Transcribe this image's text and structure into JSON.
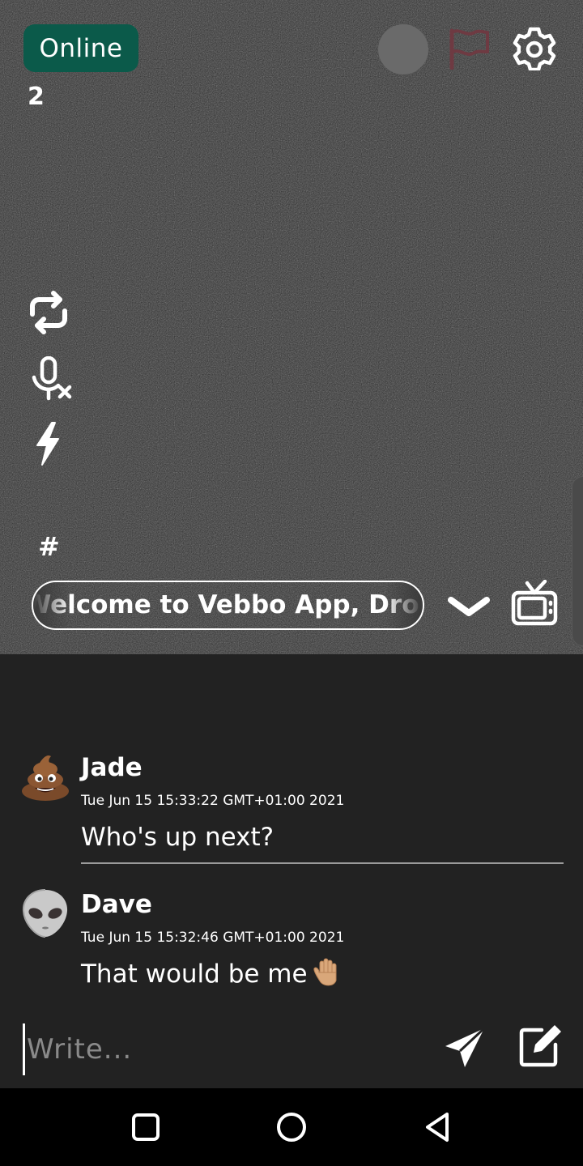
{
  "status": {
    "label": "Online",
    "count": "2"
  },
  "video": {
    "hash_label": "#",
    "topic_marquee": "Welcome to Vebbo App, Drop in and say hi"
  },
  "messages": [
    {
      "author": "Jade",
      "timestamp": "Tue Jun 15 15:33:22 GMT+01:00 2021",
      "text": "Who's up next?",
      "avatar": "poop-emoji-avatar"
    },
    {
      "author": "Dave",
      "timestamp": "Tue Jun 15 15:32:46 GMT+01:00 2021",
      "text": "That would be me",
      "avatar": "alien-face-avatar",
      "emoji": "raised-hand-emoji"
    }
  ],
  "composer": {
    "placeholder": "Write..."
  },
  "colors": {
    "online_badge": "#0b5a4a",
    "flag": "#6e3a42",
    "chat_bg": "#222222",
    "nav_bg": "#000000"
  },
  "icons": [
    "gear-icon",
    "flag-icon",
    "record-dot",
    "swap-camera-icon",
    "mic-off-icon",
    "flash-icon",
    "chevron-down-icon",
    "tv-icon",
    "send-icon",
    "compose-icon",
    "nav-recent-icon",
    "nav-home-icon",
    "nav-back-icon"
  ]
}
